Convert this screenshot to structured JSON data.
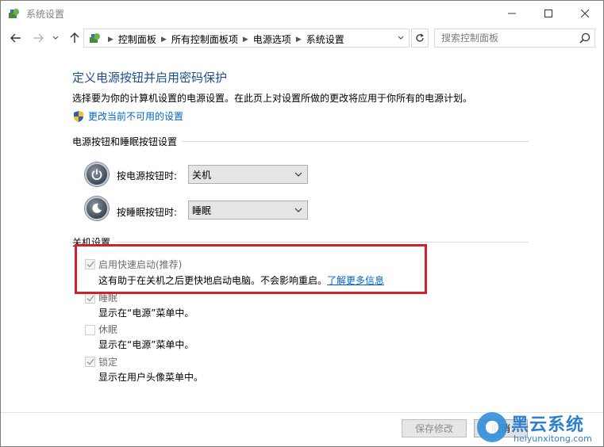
{
  "window": {
    "title": "系统设置",
    "minimize_icon": "minimize-icon",
    "maximize_icon": "maximize-icon",
    "close_icon": "close-icon"
  },
  "nav": {
    "back_icon": "arrow-left-icon",
    "forward_icon": "arrow-right-icon",
    "recent_icon": "chevron-down-icon",
    "up_icon": "arrow-up-icon",
    "breadcrumbs": [
      "控制面板",
      "所有控制面板项",
      "电源选项",
      "系统设置"
    ],
    "refresh_icon": "refresh-icon",
    "search_placeholder": "搜索控制面板"
  },
  "page": {
    "heading": "定义电源按钮并启用密码保护",
    "description": "选择要为你的计算机设置的电源设置。在此页上对设置所做的更改将应用于你所有的电源计划。",
    "change_link": "更改当前不可用的设置",
    "power_section": {
      "title": "电源按钮和睡眠按钮设置",
      "rows": [
        {
          "label": "按电源按钮时:",
          "value": "关机",
          "icon": "power-button-icon"
        },
        {
          "label": "按睡眠按钮时:",
          "value": "睡眠",
          "icon": "sleep-button-icon"
        }
      ]
    },
    "shutdown_section": {
      "title": "关机设置",
      "items": [
        {
          "label": "启用快速启动(推荐)",
          "checked": true,
          "desc": "这有助于在关机之后更快地启动电脑。不会影响重启。",
          "link": "了解更多信息"
        },
        {
          "label": "睡眠",
          "checked": true,
          "desc": "显示在“电源”菜单中。"
        },
        {
          "label": "休眠",
          "checked": false,
          "desc": "显示在“电源”菜单中。"
        },
        {
          "label": "锁定",
          "checked": true,
          "desc": "显示在用户头像菜单中。"
        }
      ]
    }
  },
  "buttons": {
    "save": "保存修改",
    "cancel": "取消"
  },
  "watermark": {
    "title": "黑云系统",
    "url": "heiyunxitong.com"
  },
  "colors": {
    "heading": "#1e4e8c",
    "link": "#0066cc",
    "highlight_box": "#d21f2a",
    "watermark": "#2f7fd0"
  }
}
